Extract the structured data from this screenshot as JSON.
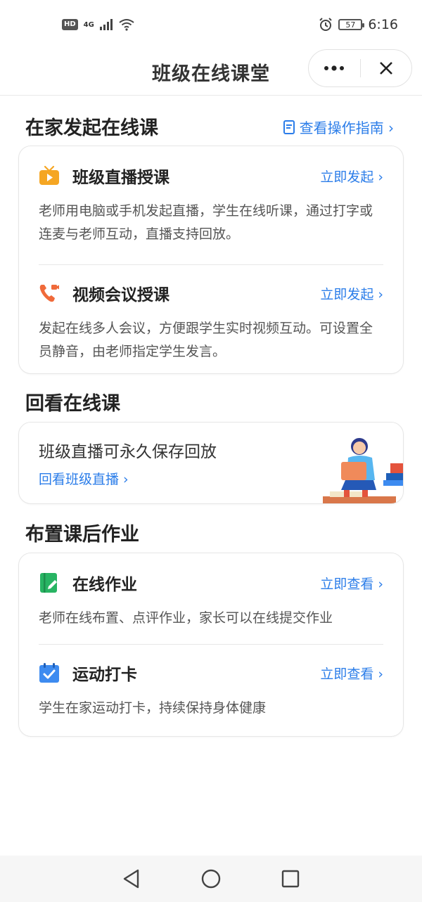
{
  "status_bar": {
    "hd": "HD",
    "network": "4G",
    "battery": "57",
    "time": "6:16"
  },
  "header": {
    "title": "班级在线课堂",
    "more_icon": "more-dots-icon",
    "close_icon": "close-icon"
  },
  "section_online": {
    "title": "在家发起在线课",
    "guide_link": "查看操作指南 ›",
    "items": [
      {
        "icon": "tv-icon",
        "title": "班级直播授课",
        "action": "立即发起 ›",
        "desc": "老师用电脑或手机发起直播，学生在线听课，通过打字或连麦与老师互动，直播支持回放。"
      },
      {
        "icon": "video-call-icon",
        "title": "视频会议授课",
        "action": "立即发起 ›",
        "desc": "发起在线多人会议，方便跟学生实时视频互动。可设置全员静音，由老师指定学生发言。"
      }
    ]
  },
  "section_replay": {
    "title": "回看在线课",
    "text": "班级直播可永久保存回放",
    "link": "回看班级直播 ›"
  },
  "section_homework": {
    "title": "布置课后作业",
    "items": [
      {
        "icon": "homework-icon",
        "title": "在线作业",
        "action": "立即查看 ›",
        "desc": "老师在线布置、点评作业，家长可以在线提交作业"
      },
      {
        "icon": "calendar-check-icon",
        "title": "运动打卡",
        "action": "立即查看 ›",
        "desc": "学生在家运动打卡，持续保持身体健康"
      }
    ]
  },
  "colors": {
    "accent": "#2b7de9",
    "orange": "#f5a623",
    "red": "#f06a3a",
    "green": "#28b463",
    "blue": "#3d8bf0"
  }
}
